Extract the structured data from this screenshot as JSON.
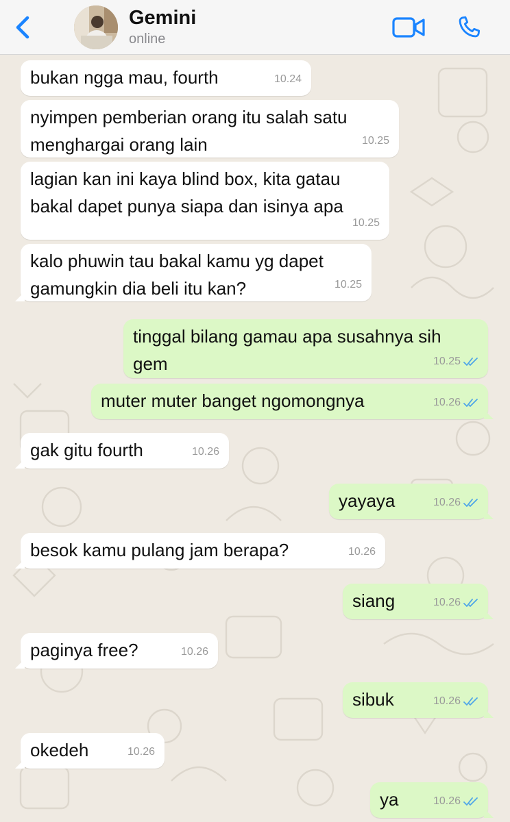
{
  "header": {
    "contact_name": "Gemini",
    "status": "online"
  },
  "colors": {
    "incoming_bubble": "#ffffff",
    "outgoing_bubble": "#dcf8c6",
    "accent": "#1a84ff",
    "read_ticks": "#4fa6e8",
    "chat_background": "#efeae2"
  },
  "icons": [
    "back-chevron-icon",
    "video-call-icon",
    "phone-icon",
    "double-check-icon"
  ],
  "messages": [
    {
      "dir": "in",
      "text": "bukan ngga mau, fourth",
      "time": "10.24"
    },
    {
      "dir": "in",
      "text": "nyimpen pemberian orang itu salah satu menghargai orang lain",
      "time": "10.25"
    },
    {
      "dir": "in",
      "text": "lagian kan ini kaya blind box, kita gatau bakal dapet punya siapa dan isinya apa",
      "time": "10.25"
    },
    {
      "dir": "in",
      "text": "kalo phuwin tau bakal kamu yg dapet gamungkin dia beli itu kan?",
      "time": "10.25"
    },
    {
      "dir": "out",
      "text": "tinggal bilang gamau apa susahnya sih gem",
      "time": "10.25",
      "read": true
    },
    {
      "dir": "out",
      "text": "muter muter banget ngomongnya",
      "time": "10.26",
      "read": true
    },
    {
      "dir": "in",
      "text": "gak gitu fourth",
      "time": "10.26"
    },
    {
      "dir": "out",
      "text": "yayaya",
      "time": "10.26",
      "read": true
    },
    {
      "dir": "in",
      "text": "besok kamu pulang jam berapa?",
      "time": "10.26"
    },
    {
      "dir": "out",
      "text": "siang",
      "time": "10.26",
      "read": true
    },
    {
      "dir": "in",
      "text": "paginya free?",
      "time": "10.26"
    },
    {
      "dir": "out",
      "text": "sibuk",
      "time": "10.26",
      "read": true
    },
    {
      "dir": "in",
      "text": "okedeh",
      "time": "10.26"
    },
    {
      "dir": "out",
      "text": "ya",
      "time": "10.26",
      "read": true
    }
  ]
}
